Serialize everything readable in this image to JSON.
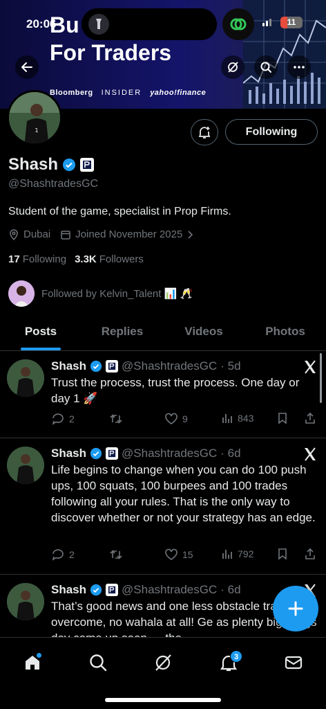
{
  "status_bar": {
    "time": "20:06",
    "battery": "11"
  },
  "banner": {
    "title_top": "Bu                    s",
    "title": "For Traders",
    "logos": [
      "Bloomberg",
      "INSIDER",
      "yahoo!finance"
    ]
  },
  "profile": {
    "name": "Shash",
    "handle": "@ShashtradesGC",
    "bio": "Student of the game, specialist in Prop Firms.",
    "location": "Dubai",
    "joined": "Joined November 2025",
    "following_count": "17",
    "following_label": "Following",
    "followers_count": "3.3K",
    "followers_label": "Followers",
    "followed_by": "Followed by Kelvin_Talent 📊 🥂",
    "follow_button": "Following"
  },
  "tabs": [
    "Posts",
    "Replies",
    "Videos",
    "Photos"
  ],
  "active_tab": "Posts",
  "tweets": [
    {
      "name": "Shash",
      "handle": "@ShashtradesGC",
      "time": "· 5d",
      "text": "Trust the process, trust the process. One day or day 1 🚀",
      "replies": "2",
      "reposts": "",
      "likes": "9",
      "views": "843"
    },
    {
      "name": "Shash",
      "handle": "@ShashtradesGC",
      "time": "· 6d",
      "text": "Life begins to change when you can do 100 push ups, 100 squats, 100 burpees and 100 trades following all your rules. That is the only way to discover whether or not your strategy has an edge.",
      "replies": "2",
      "reposts": "",
      "likes": "15",
      "views": "792"
    },
    {
      "name": "Shash",
      "handle": "@ShashtradesGC",
      "time": "· 6d",
      "text": "That’s good news and one less obstacle traders to overcome, no wahala at all! Ge as plenty big things dey come up soon — the"
    }
  ],
  "nav": {
    "notifications_badge": "3"
  },
  "colors": {
    "accent": "#1d9bf0",
    "background": "#000000",
    "muted": "#71767b"
  }
}
